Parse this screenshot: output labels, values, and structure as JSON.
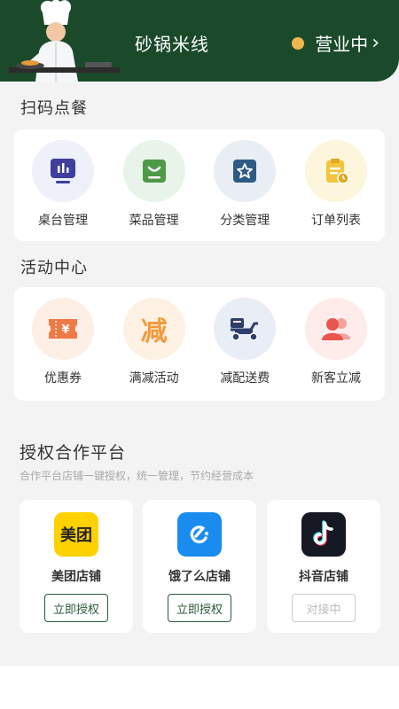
{
  "header": {
    "shop_name": "砂锅米线",
    "status_label": "营业中",
    "status_chevron": "›",
    "status_dot_color": "#f0b94f",
    "bg_color": "#1b4a2b"
  },
  "scan_order": {
    "title": "扫码点餐",
    "items": [
      {
        "label": "桌台管理",
        "icon": "table-monitor-icon"
      },
      {
        "label": "菜品管理",
        "icon": "dish-basket-icon"
      },
      {
        "label": "分类管理",
        "icon": "star-category-icon"
      },
      {
        "label": "订单列表",
        "icon": "order-clipboard-icon"
      }
    ]
  },
  "activity": {
    "title": "活动中心",
    "items": [
      {
        "label": "优惠券",
        "icon": "coupon-ticket-icon",
        "glyph": "¥"
      },
      {
        "label": "满减活动",
        "icon": "discount-reduce-icon",
        "glyph": "减"
      },
      {
        "label": "减配送费",
        "icon": "delivery-scooter-icon"
      },
      {
        "label": "新客立减",
        "icon": "new-customer-icon"
      }
    ]
  },
  "auth": {
    "title": "授权合作平台",
    "subtitle": "合作平台店铺一键授权，统一管理，节约经营成本",
    "platforms": [
      {
        "name": "美团店铺",
        "logo_text": "美团",
        "button": "立即授权",
        "enabled": true
      },
      {
        "name": "饿了么店铺",
        "logo_text": "e",
        "button": "立即授权",
        "enabled": true
      },
      {
        "name": "抖音店铺",
        "logo_text": "♪",
        "button": "对接中",
        "enabled": false
      }
    ]
  }
}
